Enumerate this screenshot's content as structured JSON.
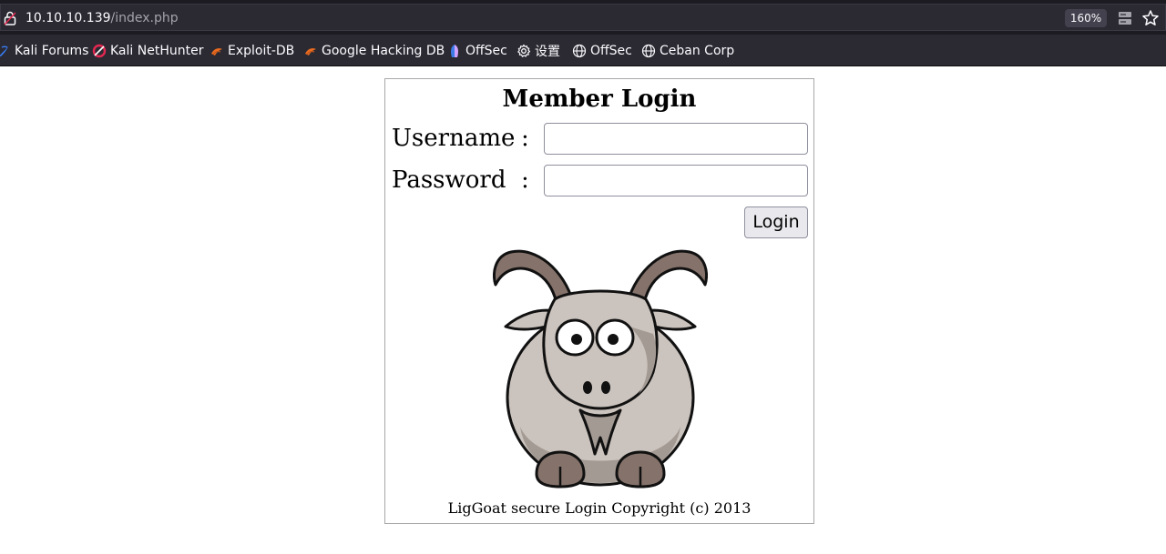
{
  "browser": {
    "url_host": "10.10.10.139",
    "url_path": "/index.php",
    "zoom": "160%",
    "bookmarks": [
      {
        "label": "Kali Forums",
        "icon": "kali-dragon-icon"
      },
      {
        "label": "Kali NetHunter",
        "icon": "nethunter-icon"
      },
      {
        "label": "Exploit-DB",
        "icon": "exploit-db-icon"
      },
      {
        "label": "Google Hacking DB",
        "icon": "ghdb-icon"
      },
      {
        "label": "OffSec",
        "icon": "offsec-icon"
      },
      {
        "label": "设置",
        "icon": "gear-icon"
      },
      {
        "label": "OffSec",
        "icon": "globe-icon"
      },
      {
        "label": "Ceban Corp",
        "icon": "globe-icon"
      }
    ]
  },
  "login": {
    "title": "Member Login",
    "username_label": "Username",
    "password_label": "Password",
    "colon": ":",
    "username_value": "",
    "password_value": "",
    "button_label": "Login",
    "copyright": "LigGoat secure Login Copyright (c) 2013"
  },
  "colors": {
    "chrome_bg": "#2b2a33",
    "goat_body": "#cbc3bd",
    "goat_horn": "#85736b"
  }
}
